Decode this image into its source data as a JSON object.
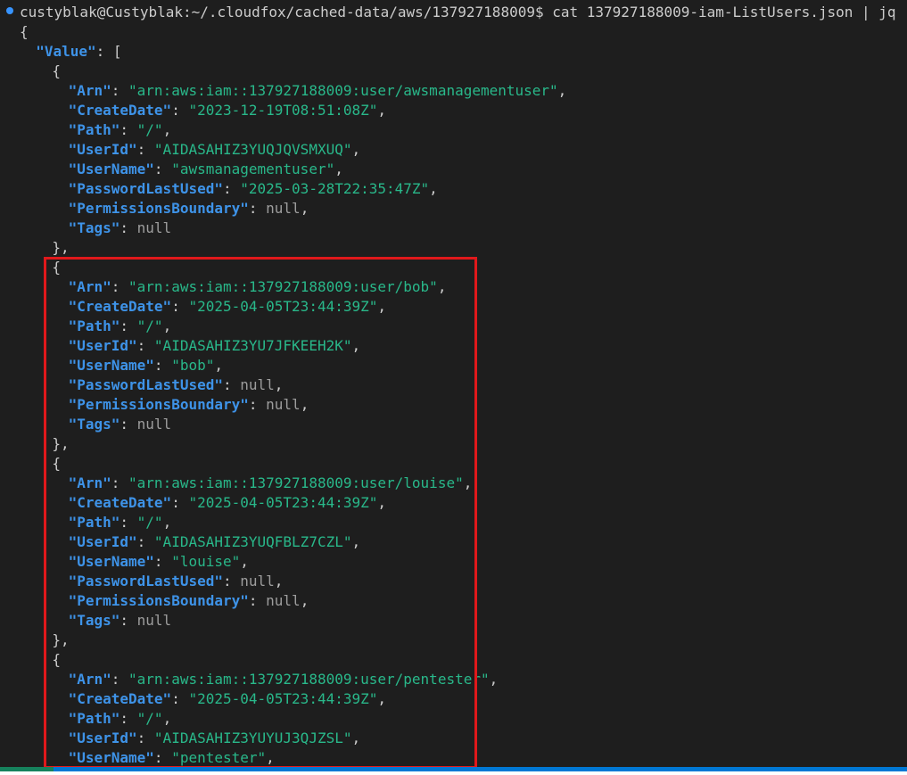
{
  "terminal": {
    "prompt": "custyblak@Custyblak:~/.cloudfox/cached-data/aws/137927188009$ cat 137927188009-iam-ListUsers.json | jq",
    "root_key": "Value",
    "users": [
      {
        "Arn": "arn:aws:iam::137927188009:user/awsmanagementuser",
        "CreateDate": "2023-12-19T08:51:08Z",
        "Path": "/",
        "UserId": "AIDASAHIZ3YUQJQVSMXUQ",
        "UserName": "awsmanagementuser",
        "PasswordLastUsed": "2025-03-28T22:35:47Z",
        "PermissionsBoundary": "null",
        "Tags": "null"
      },
      {
        "Arn": "arn:aws:iam::137927188009:user/bob",
        "CreateDate": "2025-04-05T23:44:39Z",
        "Path": "/",
        "UserId": "AIDASAHIZ3YU7JFKEEH2K",
        "UserName": "bob",
        "PasswordLastUsed": "null",
        "PermissionsBoundary": "null",
        "Tags": "null"
      },
      {
        "Arn": "arn:aws:iam::137927188009:user/louise",
        "CreateDate": "2025-04-05T23:44:39Z",
        "Path": "/",
        "UserId": "AIDASAHIZ3YUQFBLZ7CZL",
        "UserName": "louise",
        "PasswordLastUsed": "null",
        "PermissionsBoundary": "null",
        "Tags": "null"
      },
      {
        "Arn": "arn:aws:iam::137927188009:user/pentester",
        "CreateDate": "2025-04-05T23:44:39Z",
        "Path": "/",
        "UserId": "AIDASAHIZ3YUYUJ3QJZSL",
        "UserName": "pentester"
      }
    ]
  },
  "colors": {
    "background": "#1e1e1e",
    "key": "#3e93e8",
    "string": "#29b88a",
    "null": "#9d9d9d",
    "highlight": "#e0181b"
  }
}
